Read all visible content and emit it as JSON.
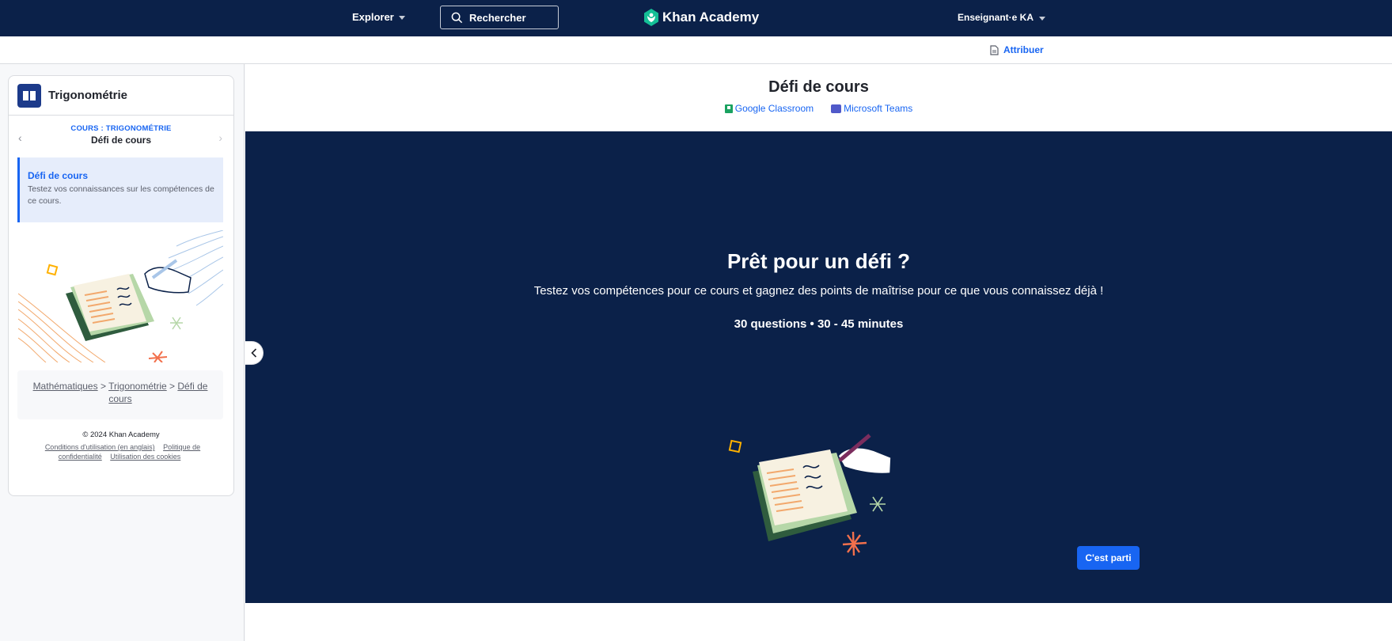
{
  "nav": {
    "explore_label": "Explorer",
    "search_placeholder": "Rechercher",
    "brand": "Khan Academy",
    "account_label": "Enseignant·e KA"
  },
  "subheader": {
    "assign_label": "Attribuer"
  },
  "sidebar": {
    "course_title": "Trigonométrie",
    "unit_kicker": "COURS : TRIGONOMÉTRIE",
    "unit_name": "Défi de cours",
    "active_item": {
      "title": "Défi de cours",
      "description": "Testez vos connaissances sur les compétences de ce cours."
    },
    "breadcrumb": {
      "items": [
        "Mathématiques",
        "Trigonométrie",
        "Défi de cours"
      ],
      "separator": ">"
    },
    "footer": {
      "copyright": "© 2024 Khan Academy",
      "links": [
        "Conditions d'utilisation (en anglais)",
        "Politique de confidentialité",
        "Utilisation des cookies"
      ]
    }
  },
  "main": {
    "title": "Défi de cours",
    "share": [
      "Google Classroom",
      "Microsoft Teams"
    ],
    "hero": {
      "title": "Prêt pour un défi ?",
      "subtitle": "Testez vos compétences pour ce cours et gagnez des points de maîtrise pour ce que vous connaissez déjà !",
      "meta": "30 questions • 30 - 45 minutes"
    },
    "start_button": "C'est parti"
  },
  "colors": {
    "nav_bg": "#0b2149",
    "accent": "#1865f2",
    "hero_bg": "#0b2149"
  }
}
